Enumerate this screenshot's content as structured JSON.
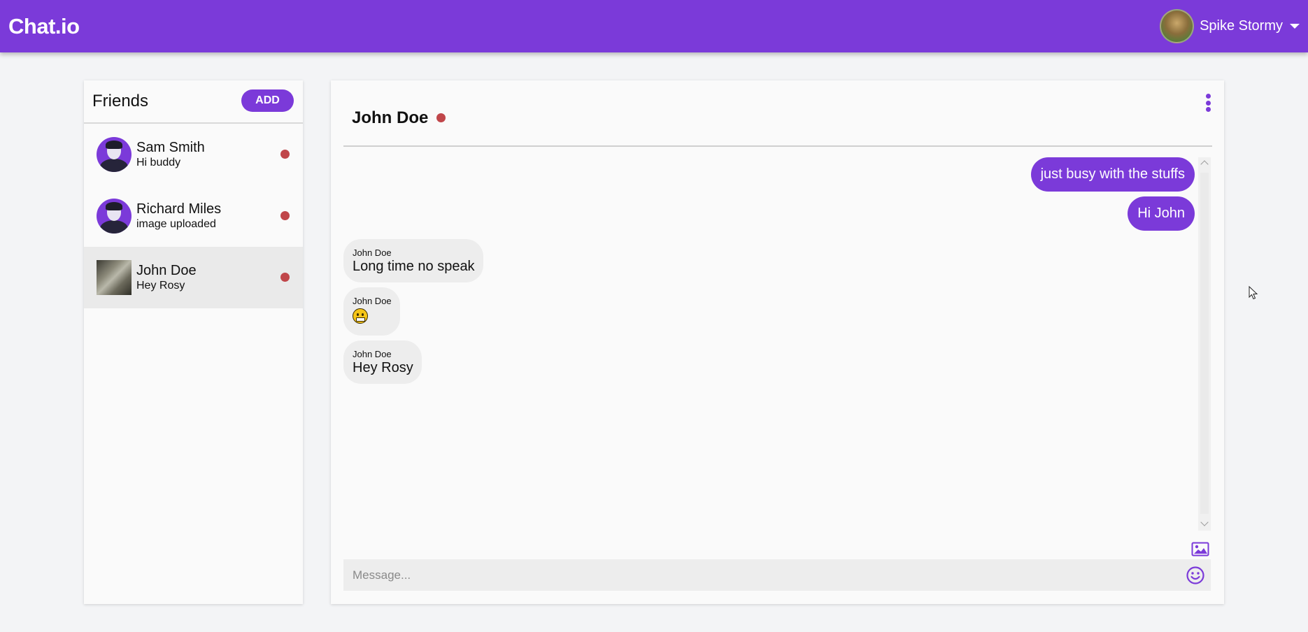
{
  "header": {
    "brand": "Chat.io",
    "user_name": "Spike Stormy"
  },
  "friends": {
    "title": "Friends",
    "add_label": "ADD",
    "items": [
      {
        "name": "Sam Smith",
        "last_message": "Hi buddy",
        "status": "offline"
      },
      {
        "name": "Richard Miles",
        "last_message": "image uploaded",
        "status": "offline"
      },
      {
        "name": "John Doe",
        "last_message": "Hey Rosy",
        "status": "offline",
        "active": true
      }
    ]
  },
  "chat": {
    "title": "John Doe",
    "messages": [
      {
        "direction": "out",
        "text": "just busy with the stuffs"
      },
      {
        "direction": "out",
        "text": "Hi John"
      },
      {
        "direction": "in",
        "sender": "John Doe",
        "text": "Long time no speak"
      },
      {
        "direction": "in",
        "sender": "John Doe",
        "text": "😀"
      },
      {
        "direction": "in",
        "sender": "John Doe",
        "text": "Hey Rosy"
      }
    ],
    "input_placeholder": "Message..."
  },
  "colors": {
    "accent": "#7b3ad9",
    "status_offline": "#c0464a",
    "page_bg": "#f3f4f6",
    "panel_bg": "#fafafa"
  },
  "icons": [
    "chevron-down-icon",
    "more-vertical-icon",
    "image-icon",
    "smile-icon",
    "mouse-cursor-icon"
  ]
}
